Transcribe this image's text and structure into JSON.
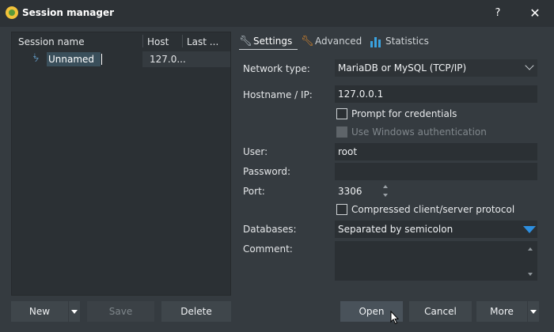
{
  "window": {
    "title": "Session manager",
    "help_label": "?",
    "close_label": "✕"
  },
  "icons": {
    "app": "heidisql-logo-icon",
    "session": "mysql-dolphin-icon",
    "settings_tab": "wrench-icon",
    "advanced_tab": "wrench-orange-icon",
    "statistics_tab": "bar-chart-icon"
  },
  "session_tree": {
    "columns": [
      "Session name",
      "Host",
      "Last ..."
    ],
    "rows": [
      {
        "name": "Unnamed",
        "host": "127.0..."
      }
    ]
  },
  "left_buttons": {
    "new": "New",
    "save": "Save",
    "delete": "Delete"
  },
  "tabs": [
    "Settings",
    "Advanced",
    "Statistics"
  ],
  "form": {
    "network_type_label": "Network type:",
    "network_type_value": "MariaDB or MySQL (TCP/IP)",
    "hostname_label": "Hostname / IP:",
    "hostname_value": "127.0.0.1",
    "prompt_credentials": "Prompt for credentials",
    "windows_auth": "Use Windows authentication",
    "user_label": "User:",
    "user_value": "root",
    "password_label": "Password:",
    "password_value": "",
    "port_label": "Port:",
    "port_value": "3306",
    "compressed_protocol": "Compressed client/server protocol",
    "databases_label": "Databases:",
    "databases_value": "Separated by semicolon",
    "comment_label": "Comment:",
    "comment_value": ""
  },
  "right_buttons": {
    "open": "Open",
    "cancel": "Cancel",
    "more": "More"
  },
  "colors": {
    "background": "#353b40",
    "field": "#2b3034",
    "accent_blue": "#2d8fe0",
    "wrench_orange": "#e08a2b"
  }
}
